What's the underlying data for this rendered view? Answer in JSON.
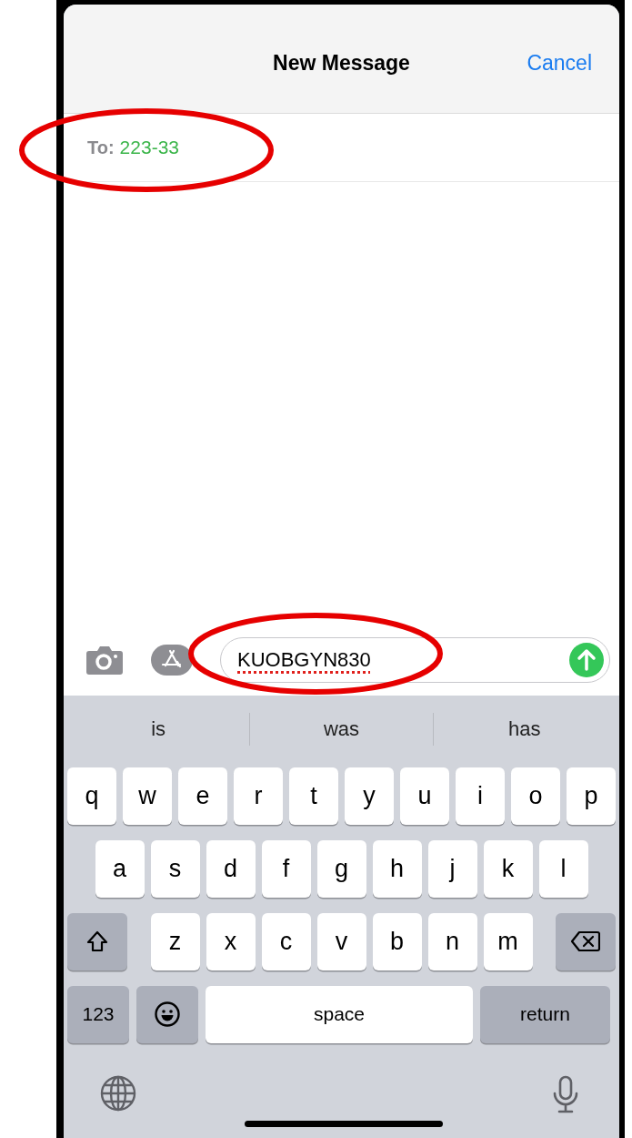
{
  "header": {
    "title": "New Message",
    "cancel": "Cancel"
  },
  "recipient": {
    "label": "To:",
    "value": "223-33"
  },
  "composer": {
    "value": "KUOBGYN830",
    "misspelled": true
  },
  "suggestions": [
    "is",
    "was",
    "has"
  ],
  "keyboard": {
    "rows": [
      [
        "q",
        "w",
        "e",
        "r",
        "t",
        "y",
        "u",
        "i",
        "o",
        "p"
      ],
      [
        "a",
        "s",
        "d",
        "f",
        "g",
        "h",
        "j",
        "k",
        "l"
      ],
      [
        "z",
        "x",
        "c",
        "v",
        "b",
        "n",
        "m"
      ]
    ],
    "numbers_key": "123",
    "space_key": "space",
    "return_key": "return"
  },
  "annotations": [
    {
      "kind": "ellipse"
    },
    {
      "kind": "ellipse"
    }
  ]
}
